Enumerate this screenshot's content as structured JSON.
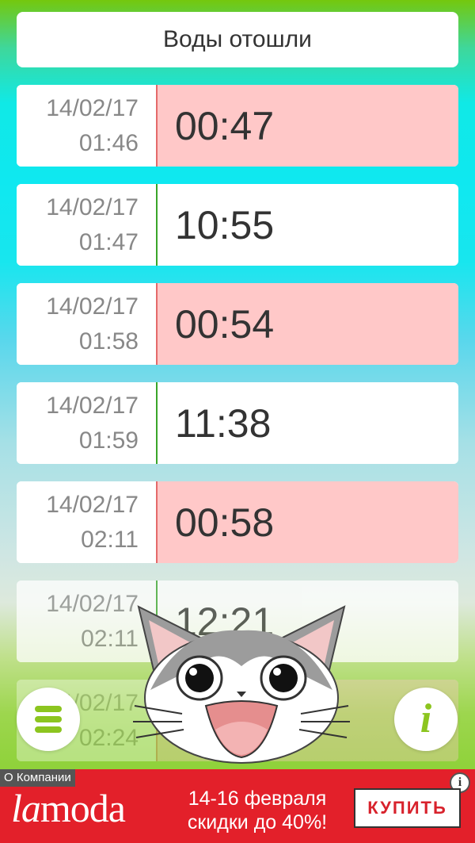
{
  "header": {
    "title": "Воды отошли"
  },
  "rows": [
    {
      "date": "14/02/17",
      "time": "01:46",
      "duration": "00:47",
      "type": "contraction"
    },
    {
      "date": "14/02/17",
      "time": "01:47",
      "duration": "10:55",
      "type": "interval"
    },
    {
      "date": "14/02/17",
      "time": "01:58",
      "duration": "00:54",
      "type": "contraction"
    },
    {
      "date": "14/02/17",
      "time": "01:59",
      "duration": "11:38",
      "type": "interval"
    },
    {
      "date": "14/02/17",
      "time": "02:11",
      "duration": "00:58",
      "type": "contraction"
    },
    {
      "date": "14/02/17",
      "time": "02:11",
      "duration": "12:21",
      "type": "interval"
    },
    {
      "date": "14/02/17",
      "time": "02:24",
      "duration": "",
      "type": "contraction"
    }
  ],
  "buttons": {
    "menu_icon": "hamburger-icon",
    "info_icon": "info-icon",
    "info_glyph": "i"
  },
  "mascot": "cat-mascot",
  "ad": {
    "corner_label": "О Компании",
    "brand": "lamoda",
    "promo_line1": "14-16 февраля",
    "promo_line2": "скидки до 40%!",
    "buy_label": "КУПИТЬ",
    "info_glyph": "i"
  },
  "colors": {
    "contraction_bg": "#ffc8c8",
    "accent_green": "#8cc51f",
    "ad_red": "#e3202a"
  }
}
